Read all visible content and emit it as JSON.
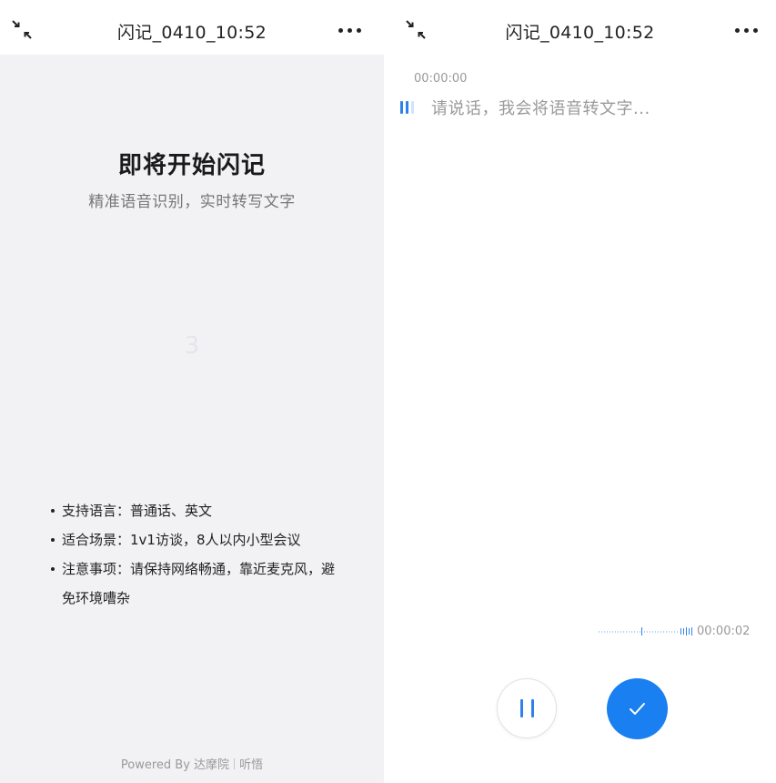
{
  "left_screen": {
    "header": {
      "collapse_icon": "collapse-arrows-icon",
      "title": "闪记_0410_10:52",
      "more_icon": "more-dots-icon"
    },
    "hero": {
      "title": "即将开始闪记",
      "subtitle": "精准语音识别，实时转写文字"
    },
    "countdown": "3",
    "tips": [
      "支持语言：普通话、英文",
      "适合场景：1v1访谈，8人以内小型会议",
      "注意事项：请保持网络畅通，靠近麦克风，避免环境嘈杂"
    ],
    "footer": {
      "powered_by": "Powered By 达摩院",
      "brand": "听悟"
    }
  },
  "right_screen": {
    "header": {
      "collapse_icon": "collapse-arrows-icon",
      "title": "闪记_0410_10:52",
      "more_icon": "more-dots-icon"
    },
    "transcript": {
      "timestamp": "00:00:00",
      "speaking_icon": "voice-level-icon",
      "prompt": "请说话，我会将语音转文字..."
    },
    "recording": {
      "waveform_icon": "audio-waveform-icon",
      "duration": "00:00:02"
    },
    "controls": {
      "pause_icon": "pause-icon",
      "confirm_icon": "check-icon"
    }
  },
  "colors": {
    "accent": "#1a7ff0",
    "panel_background": "#f2f2f5",
    "muted_text": "#999999"
  }
}
